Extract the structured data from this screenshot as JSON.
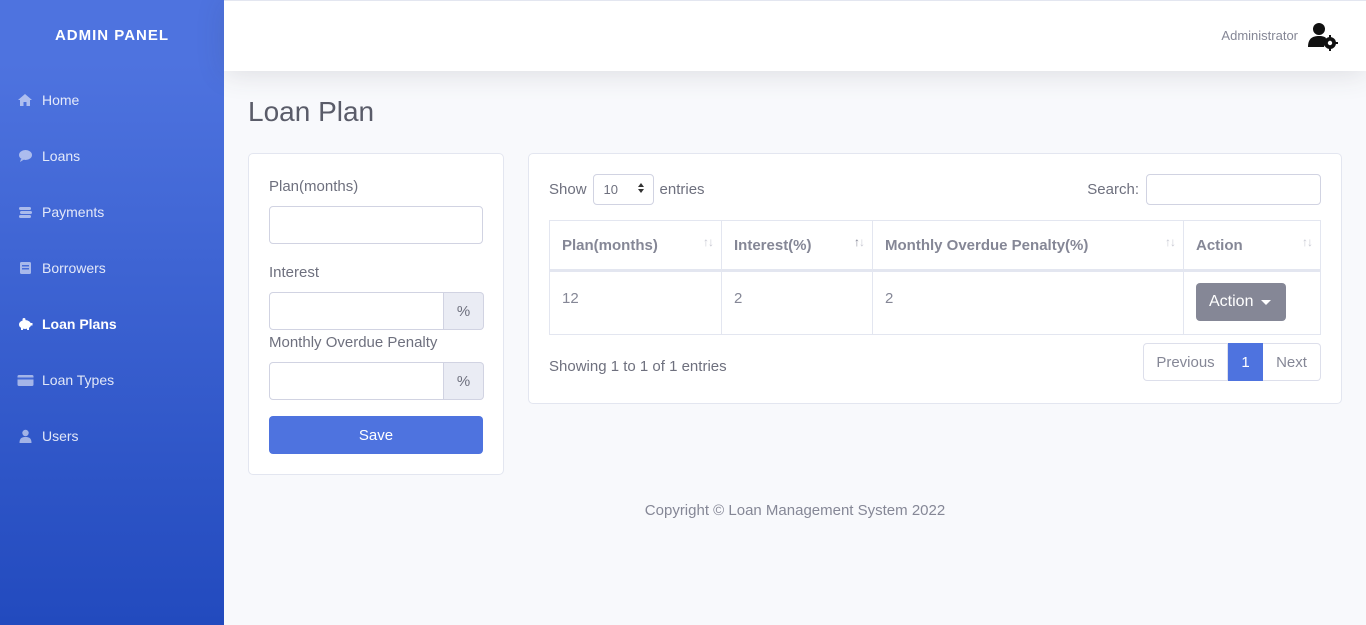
{
  "sidebar": {
    "brand": "ADMIN PANEL",
    "items": [
      {
        "label": "Home",
        "icon": "home-icon"
      },
      {
        "label": "Loans",
        "icon": "chat-icon"
      },
      {
        "label": "Payments",
        "icon": "coins-icon"
      },
      {
        "label": "Borrowers",
        "icon": "book-icon"
      },
      {
        "label": "Loan Plans",
        "icon": "piggy-bank-icon",
        "active": true
      },
      {
        "label": "Loan Types",
        "icon": "card-icon"
      },
      {
        "label": "Users",
        "icon": "user-icon"
      }
    ]
  },
  "topbar": {
    "user_name": "Administrator",
    "avatar_icon": "user-cog-icon"
  },
  "page": {
    "title": "Loan Plan"
  },
  "form": {
    "plan_label": "Plan(months)",
    "plan_value": "",
    "interest_label": "Interest",
    "interest_value": "",
    "interest_addon": "%",
    "penalty_label": "Monthly Overdue Penalty",
    "penalty_value": "",
    "penalty_addon": "%",
    "save_label": "Save"
  },
  "table": {
    "show_label": "Show",
    "entries_value": "10",
    "entries_label": "entries",
    "search_label": "Search:",
    "search_value": "",
    "columns": [
      "Plan(months)",
      "Interest(%)",
      "Monthly Overdue Penalty(%)",
      "Action"
    ],
    "rows": [
      {
        "plan": "12",
        "interest": "2",
        "penalty": "2",
        "action": "Action"
      }
    ],
    "info": "Showing 1 to 1 of 1 entries",
    "pagination": {
      "previous": "Previous",
      "current": "1",
      "next": "Next"
    }
  },
  "footer": {
    "copyright": "Copyright © Loan Management System 2022"
  },
  "colors": {
    "primary": "#4e73df",
    "secondary": "#858796",
    "background": "#f8f9fc"
  }
}
